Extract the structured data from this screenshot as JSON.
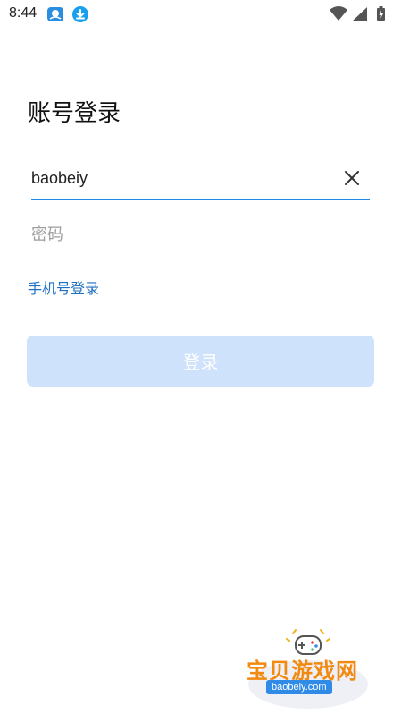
{
  "status_bar": {
    "time": "8:44",
    "icons": [
      "app-notification-icon",
      "download-icon",
      "wifi-icon",
      "signal-icon",
      "battery-icon"
    ]
  },
  "login": {
    "title": "账号登录",
    "username": {
      "value": "baobeiy"
    },
    "password": {
      "placeholder": "密码"
    },
    "alt_login_link": "手机号登录",
    "submit_label": "登录"
  },
  "watermark": {
    "site_name": "宝贝游戏网",
    "url": "baobeiy.com"
  },
  "colors": {
    "accent": "#1e88e5",
    "link": "#1e6fc0",
    "button_disabled_bg": "#cfe2fb",
    "watermark_orange": "#f28a12"
  }
}
